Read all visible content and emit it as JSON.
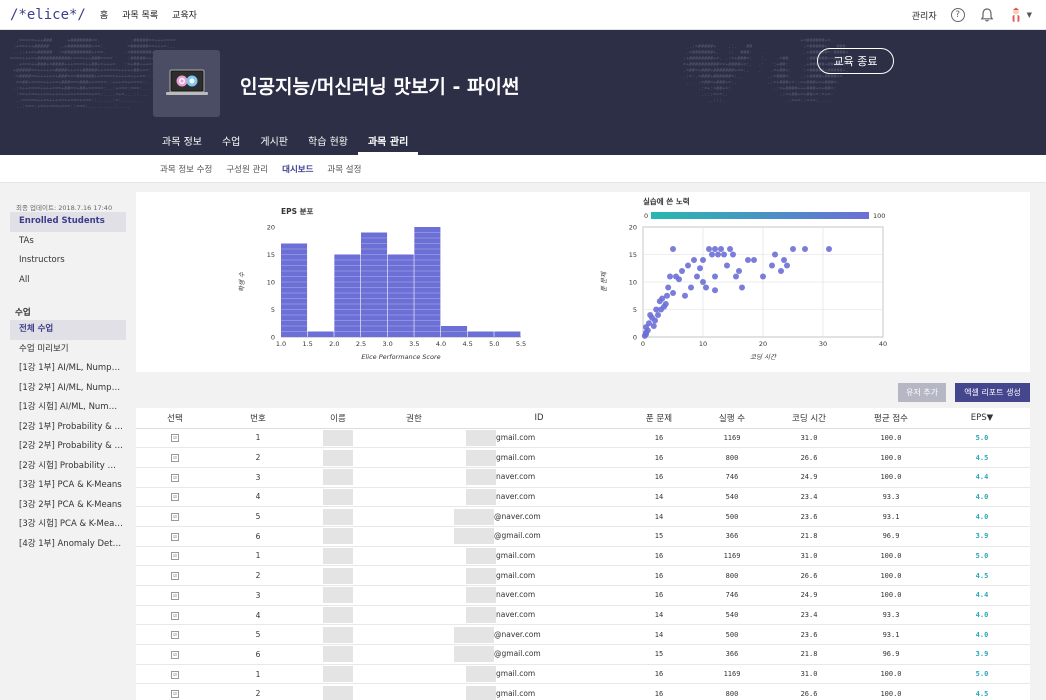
{
  "nav": {
    "logo": "/*elice*/",
    "links": [
      "홈",
      "과목 목록",
      "교육자"
    ],
    "admin": "관리자",
    "help": "?"
  },
  "banner": {
    "title": "인공지능/머신러닝 맛보기 - 파이썬",
    "end_button": "교육 종료",
    "tabs": [
      "과목 정보",
      "수업",
      "게시판",
      "학습 현황",
      "과목 관리"
    ]
  },
  "subnav": [
    "과목 정보 수정",
    "구성원 관리",
    "대시보드",
    "과목 설정"
  ],
  "sidebar": {
    "updated": "최종 업데이트: 2018.7.16 17:40",
    "groups": [
      "Enrolled Students",
      "TAs",
      "Instructors",
      "All"
    ],
    "lessons_title": "수업",
    "lessons": [
      "전체 수업",
      "수업 미리보기",
      "[1강 1부] AI/ML, Nump…",
      "[1강 2부] AI/ML, Nump…",
      "[1강 시험] AI/ML, Num…",
      "[2강 1부] Probability & …",
      "[2강 2부] Probability & …",
      "[2강 시험] Probability …",
      "[3강 1부] PCA & K-Means",
      "[3강 2부] PCA & K-Means",
      "[3강 시험] PCA & K-Mea…",
      "[4강 1부] Anomaly Det…"
    ]
  },
  "chart_data": [
    {
      "type": "bar",
      "title": "EPS 분포",
      "xlabel": "Elice Performance Score",
      "ylabel": "학생 수",
      "x_edges": [
        1.0,
        1.5,
        2.0,
        2.5,
        3.0,
        3.5,
        4.0,
        4.5,
        5.0,
        5.5
      ],
      "xticks": [
        "1.0",
        "1.5",
        "2.0",
        "2.5",
        "3.0",
        "3.5",
        "4.0",
        "4.5",
        "5.0",
        "5.5"
      ],
      "values": [
        17,
        1,
        15,
        19,
        15,
        20,
        2,
        1,
        1
      ],
      "ylim": [
        0,
        20
      ],
      "yticks": [
        0,
        5,
        10,
        15,
        20
      ],
      "color": "#6b6fd6"
    },
    {
      "type": "scatter",
      "title": "실습에 쓴 노력",
      "xlabel": "코딩 시간",
      "ylabel": "푼 문제",
      "colorbar": {
        "min": "0",
        "max": "100"
      },
      "xlim": [
        0,
        40
      ],
      "ylim": [
        0,
        20
      ],
      "xticks": [
        0,
        10,
        20,
        30,
        40
      ],
      "yticks": [
        0,
        5,
        10,
        15,
        20
      ],
      "points": [
        [
          0.3,
          0.2
        ],
        [
          0.5,
          0.5
        ],
        [
          0.8,
          1.2
        ],
        [
          0.5,
          1.8
        ],
        [
          1.0,
          2.5
        ],
        [
          1.5,
          3.5
        ],
        [
          1.2,
          4.0
        ],
        [
          2.0,
          3.0
        ],
        [
          2.2,
          5.0
        ],
        [
          2.5,
          4.0
        ],
        [
          2.8,
          6.5
        ],
        [
          3.0,
          5.0
        ],
        [
          3.2,
          7.0
        ],
        [
          3.5,
          5.5
        ],
        [
          3.8,
          6.0
        ],
        [
          4.0,
          7.5
        ],
        [
          4.2,
          9.0
        ],
        [
          4.5,
          11.0
        ],
        [
          5.0,
          8.0
        ],
        [
          5.5,
          11.0
        ],
        [
          5.0,
          16.0
        ],
        [
          6.0,
          10.5
        ],
        [
          6.5,
          12.0
        ],
        [
          7.0,
          7.5
        ],
        [
          7.5,
          13.0
        ],
        [
          8.0,
          9.0
        ],
        [
          8.5,
          14.0
        ],
        [
          9.0,
          11.0
        ],
        [
          9.5,
          12.5
        ],
        [
          10.0,
          10.0
        ],
        [
          10.0,
          14.0
        ],
        [
          10.5,
          9.0
        ],
        [
          11.0,
          16.0
        ],
        [
          11.5,
          15.0
        ],
        [
          12.0,
          16.0
        ],
        [
          12.0,
          11.0
        ],
        [
          12.5,
          15.0
        ],
        [
          12.0,
          8.5
        ],
        [
          13.0,
          16.0
        ],
        [
          13.5,
          15.0
        ],
        [
          14.0,
          13.0
        ],
        [
          14.5,
          16.0
        ],
        [
          15.0,
          15.0
        ],
        [
          15.5,
          11.0
        ],
        [
          16.0,
          12.0
        ],
        [
          16.5,
          9.0
        ],
        [
          17.5,
          14.0
        ],
        [
          18.5,
          14.0
        ],
        [
          20.0,
          11.0
        ],
        [
          21.5,
          13.0
        ],
        [
          22.0,
          15.0
        ],
        [
          23.0,
          12.0
        ],
        [
          23.5,
          14.0
        ],
        [
          24.0,
          13.0
        ],
        [
          25.0,
          16.0
        ],
        [
          27.0,
          16.0
        ],
        [
          31.0,
          16.0
        ],
        [
          0.5,
          0.8
        ],
        [
          1.8,
          2.0
        ]
      ],
      "color": "#6b6fd6"
    }
  ],
  "buttons": {
    "add": "유저 추가",
    "report": "엑셀 리포트 생성"
  },
  "table": {
    "headers": [
      "선택",
      "번호",
      "이름",
      "권한",
      "ID",
      "푼 문제",
      "실행 수",
      "코딩 시간",
      "평균 점수",
      "EPS▼"
    ],
    "checkbox": "☑",
    "rows": [
      [
        "1",
        "gmail.com",
        "16",
        "1169",
        "31.0",
        "100.0",
        "5.0"
      ],
      [
        "2",
        "gmail.com",
        "16",
        "800",
        "26.6",
        "100.0",
        "4.5"
      ],
      [
        "3",
        "naver.com",
        "16",
        "746",
        "24.9",
        "100.0",
        "4.4"
      ],
      [
        "4",
        "naver.com",
        "14",
        "540",
        "23.4",
        "93.3",
        "4.0"
      ],
      [
        "5",
        "@naver.com",
        "14",
        "500",
        "23.6",
        "93.1",
        "4.0"
      ],
      [
        "6",
        "@gmail.com",
        "15",
        "366",
        "21.8",
        "96.9",
        "3.9"
      ],
      [
        "1",
        "gmail.com",
        "16",
        "1169",
        "31.0",
        "100.0",
        "5.0"
      ],
      [
        "2",
        "gmail.com",
        "16",
        "800",
        "26.6",
        "100.0",
        "4.5"
      ],
      [
        "3",
        "naver.com",
        "16",
        "746",
        "24.9",
        "100.0",
        "4.4"
      ],
      [
        "4",
        "naver.com",
        "14",
        "540",
        "23.4",
        "93.3",
        "4.0"
      ],
      [
        "5",
        "@naver.com",
        "14",
        "500",
        "23.6",
        "93.1",
        "4.0"
      ],
      [
        "6",
        "@gmail.com",
        "15",
        "366",
        "21.8",
        "96.9",
        "3.9"
      ],
      [
        "1",
        "gmail.com",
        "16",
        "1169",
        "31.0",
        "100.0",
        "5.0"
      ],
      [
        "2",
        "gmail.com",
        "16",
        "800",
        "26.6",
        "100.0",
        "4.5"
      ]
    ]
  }
}
